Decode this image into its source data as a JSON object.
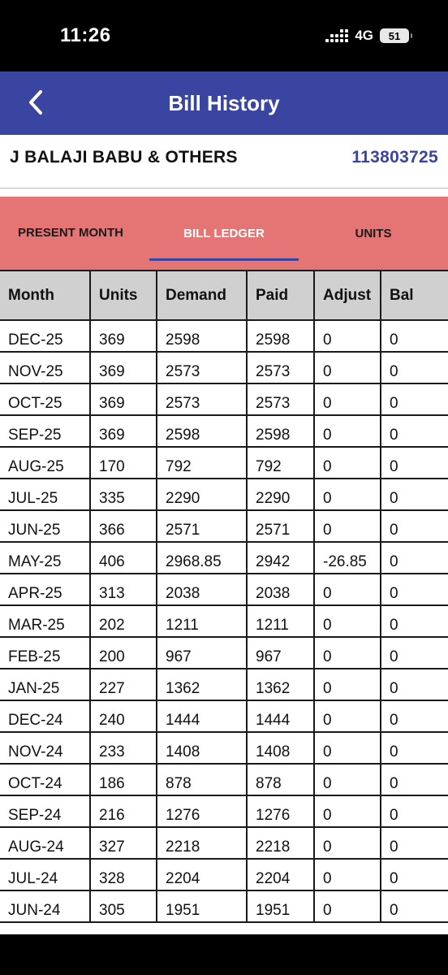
{
  "status_bar": {
    "time": "11:26",
    "network": "4G",
    "battery": "51"
  },
  "app_bar": {
    "title": "Bill History",
    "back_icon": "chevron-left-icon",
    "color": "#3a44a1"
  },
  "consumer": {
    "name": "J BALAJI BABU & OTHERS",
    "number": "113803725"
  },
  "tabs": {
    "present_month": "PRESENT MONTH",
    "bill_ledger": "BILL LEDGER",
    "units": "UNITS",
    "active": "bill_ledger",
    "background": "#e57575"
  },
  "table": {
    "headers": [
      "Month",
      "Units",
      "Demand",
      "Paid",
      "Adjust",
      "Bal"
    ],
    "rows": [
      [
        "DEC-25",
        "369",
        "2598",
        "2598",
        "0",
        "0"
      ],
      [
        "NOV-25",
        "369",
        "2573",
        "2573",
        "0",
        "0"
      ],
      [
        "OCT-25",
        "369",
        "2573",
        "2573",
        "0",
        "0"
      ],
      [
        "SEP-25",
        "369",
        "2598",
        "2598",
        "0",
        "0"
      ],
      [
        "AUG-25",
        "170",
        "792",
        "792",
        "0",
        "0"
      ],
      [
        "JUL-25",
        "335",
        "2290",
        "2290",
        "0",
        "0"
      ],
      [
        "JUN-25",
        "366",
        "2571",
        "2571",
        "0",
        "0"
      ],
      [
        "MAY-25",
        "406",
        "2968.85",
        "2942",
        "-26.85",
        "0"
      ],
      [
        "APR-25",
        "313",
        "2038",
        "2038",
        "0",
        "0"
      ],
      [
        "MAR-25",
        "202",
        "1211",
        "1211",
        "0",
        "0"
      ],
      [
        "FEB-25",
        "200",
        "967",
        "967",
        "0",
        "0"
      ],
      [
        "JAN-25",
        "227",
        "1362",
        "1362",
        "0",
        "0"
      ],
      [
        "DEC-24",
        "240",
        "1444",
        "1444",
        "0",
        "0"
      ],
      [
        "NOV-24",
        "233",
        "1408",
        "1408",
        "0",
        "0"
      ],
      [
        "OCT-24",
        "186",
        "878",
        "878",
        "0",
        "0"
      ],
      [
        "SEP-24",
        "216",
        "1276",
        "1276",
        "0",
        "0"
      ],
      [
        "AUG-24",
        "327",
        "2218",
        "2218",
        "0",
        "0"
      ],
      [
        "JUL-24",
        "328",
        "2204",
        "2204",
        "0",
        "0"
      ],
      [
        "JUN-24",
        "305",
        "1951",
        "1951",
        "0",
        "0"
      ]
    ]
  }
}
